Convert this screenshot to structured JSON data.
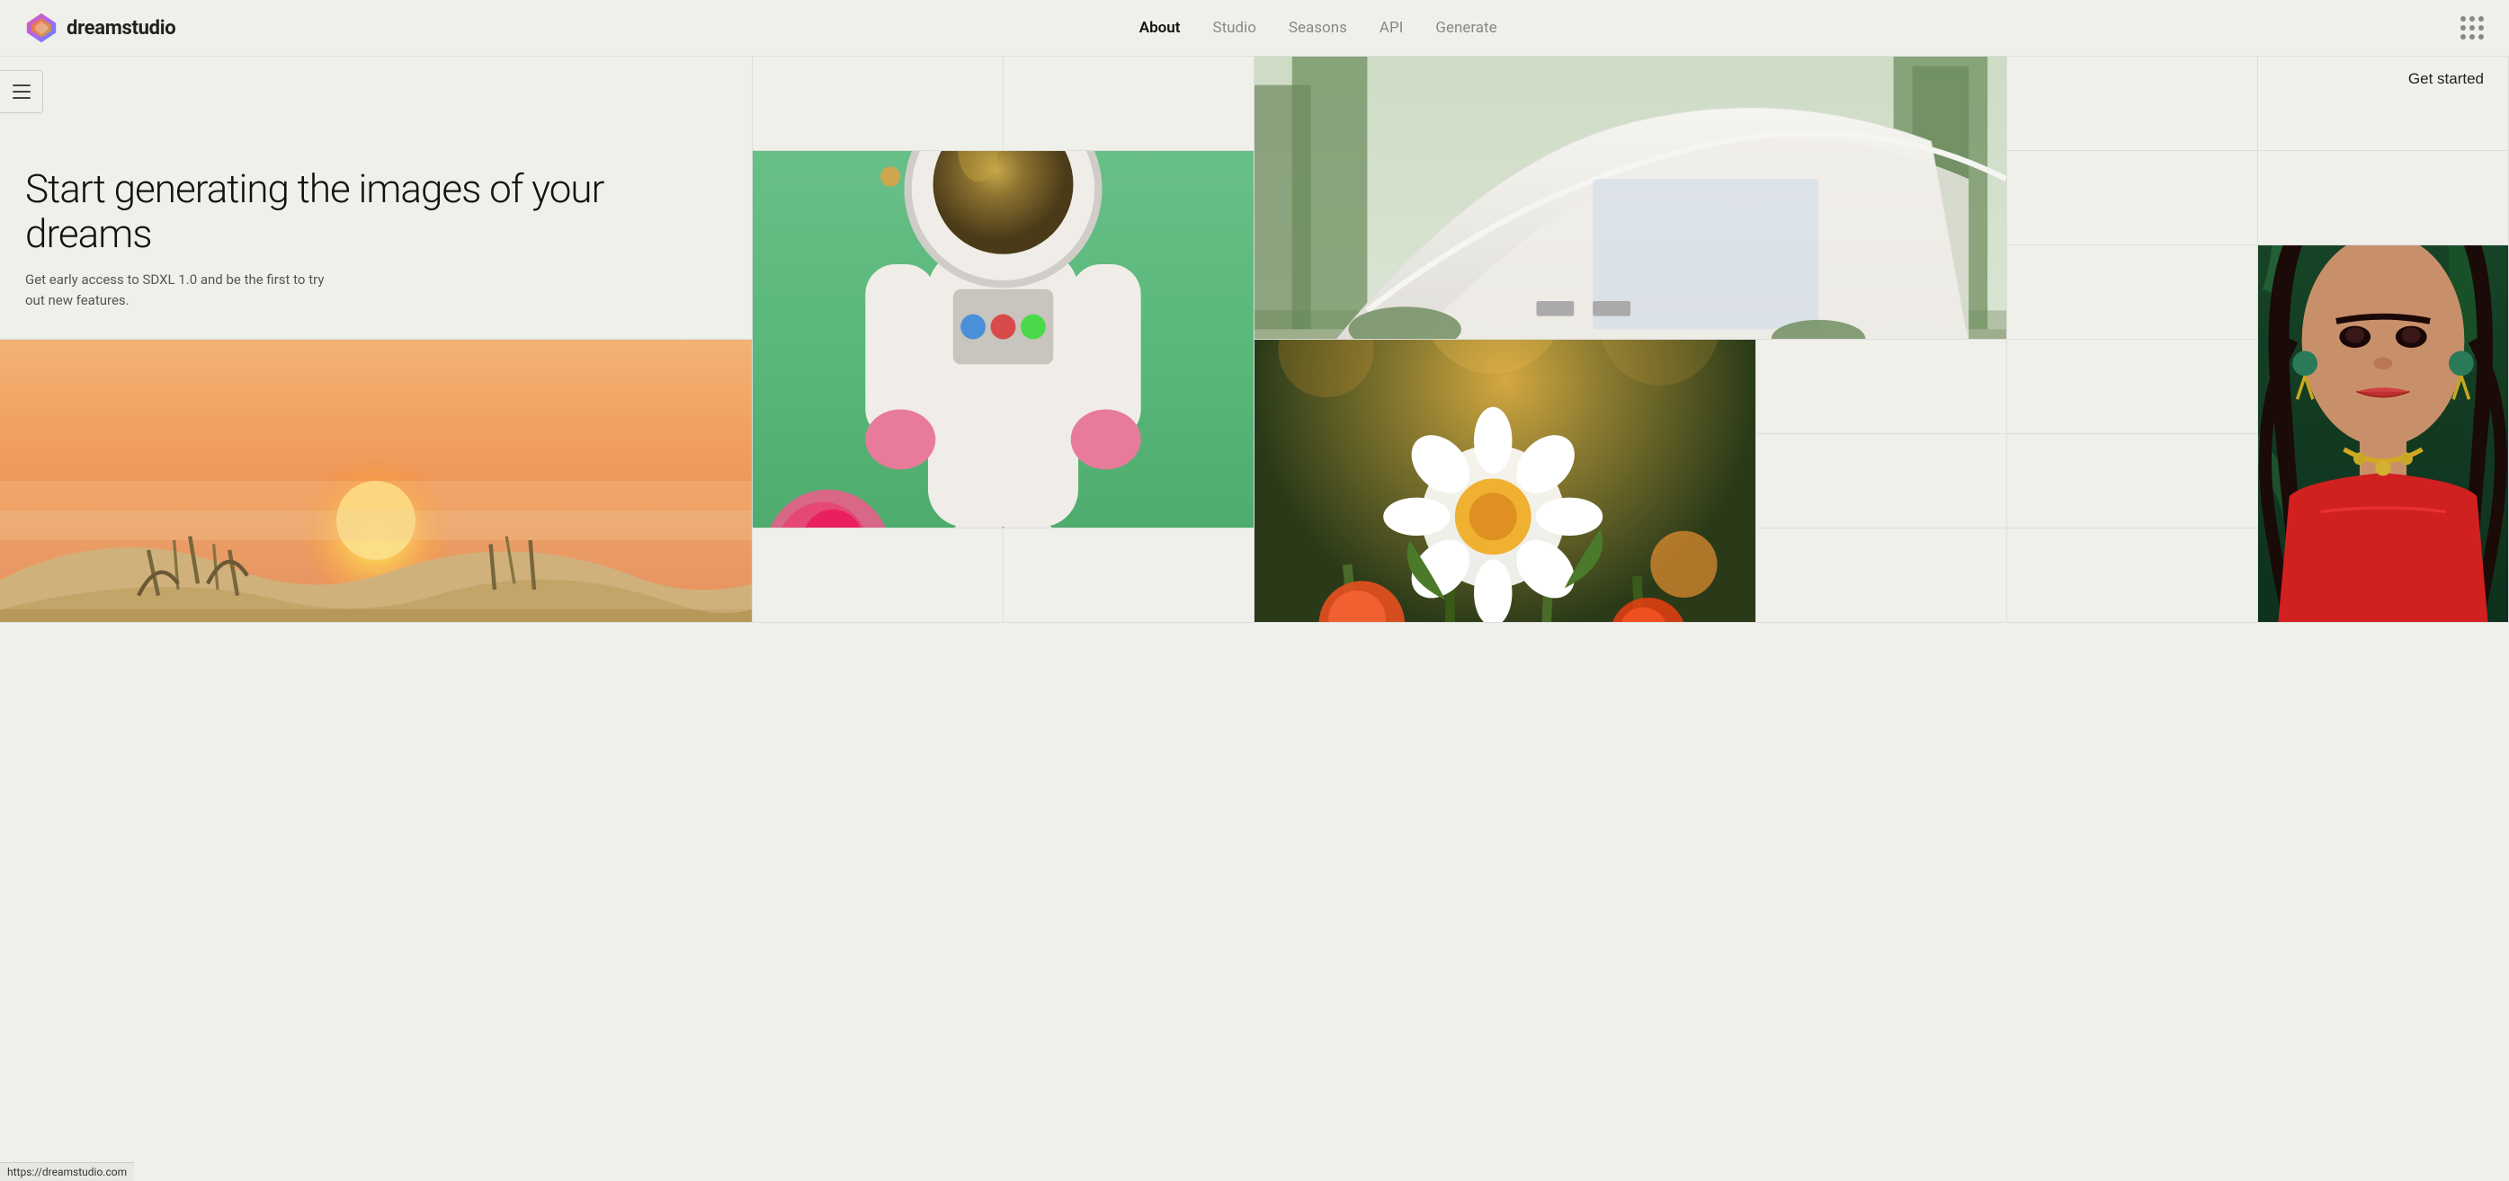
{
  "nav": {
    "logo_text_normal": "dream",
    "logo_text_bold": "studio",
    "links": [
      {
        "label": "About",
        "active": true
      },
      {
        "label": "Studio",
        "active": false
      },
      {
        "label": "Seasons",
        "active": false
      },
      {
        "label": "API",
        "active": false
      },
      {
        "label": "Generate",
        "active": false
      }
    ]
  },
  "sidebar": {
    "toggle_label": "☰"
  },
  "hero": {
    "get_started": "Get started",
    "title": "Start generating the images of your dreams",
    "subtitle": "Get early access to SDXL 1.0 and be the first to try out new features."
  },
  "status_bar": {
    "url": "https://dreamstudio.com"
  }
}
